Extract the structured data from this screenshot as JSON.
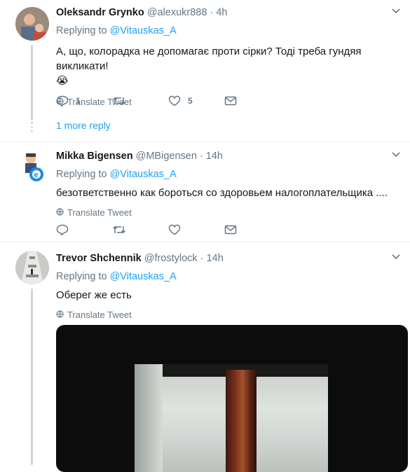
{
  "tweets": [
    {
      "name": "Oleksandr Grynko",
      "handle": "@alexukr888",
      "time": "4h",
      "reply_prefix": "Replying to",
      "reply_to": "@Vitauskas_A",
      "text": "А, що, колорадка не допомагає проти сірки? Тоді треба гундяя викликати!",
      "emoji": "😭",
      "translate": "Translate Tweet",
      "reply_count": "1",
      "retweet_count": "",
      "like_count": "5",
      "more_replies": "1 more reply"
    },
    {
      "name": "Mikka Bigensen",
      "handle": "@MBigensen",
      "time": "14h",
      "reply_prefix": "Replying to",
      "reply_to": "@Vitauskas_A",
      "text": "безответственно как бороться со здоровьем налогоплательщика ....",
      "translate": "Translate Tweet",
      "reply_count": "",
      "retweet_count": "",
      "like_count": ""
    },
    {
      "name": "Trevor Shchennik",
      "handle": "@frostylock",
      "time": "14h",
      "reply_prefix": "Replying to",
      "reply_to": "@Vitauskas_A",
      "text": "Оберег же есть",
      "translate": "Translate Tweet"
    }
  ],
  "icons": {
    "reply": "reply-icon",
    "retweet": "retweet-icon",
    "like": "heart-icon",
    "dm": "envelope-icon",
    "globe": "globe-icon",
    "caret": "chevron-down-icon"
  },
  "colors": {
    "link": "#1da1f2",
    "muted": "#657786",
    "thread": "#ccd6dd"
  }
}
